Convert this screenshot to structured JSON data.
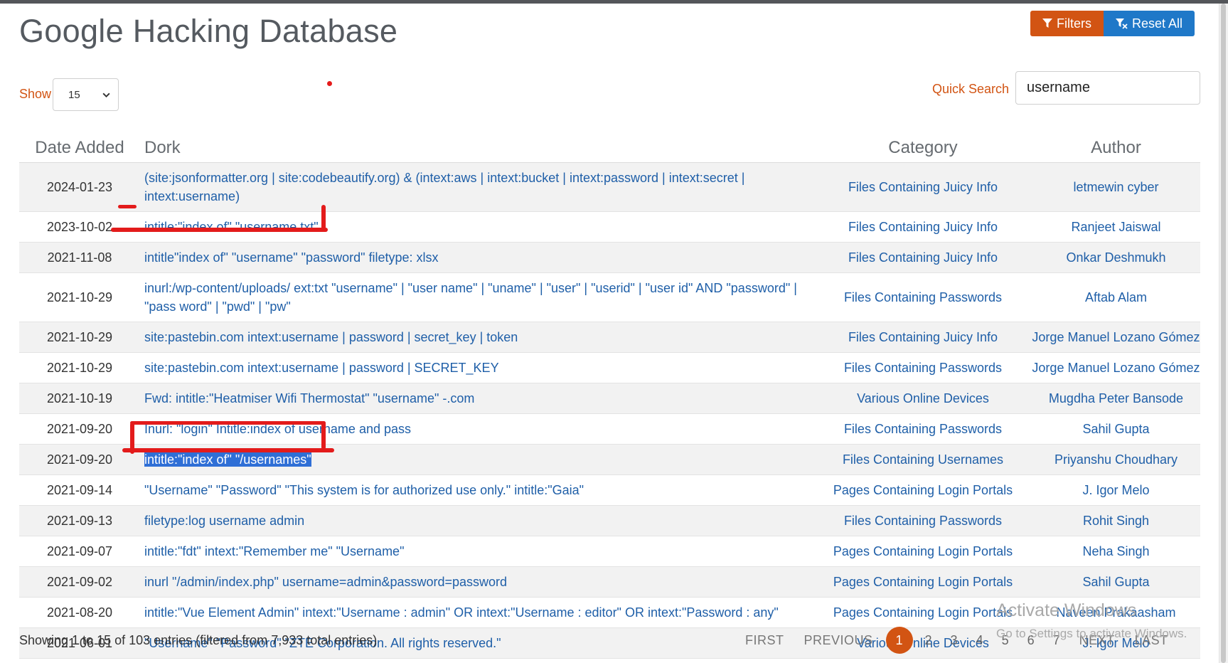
{
  "header": {
    "title": "Google Hacking Database",
    "filters_label": "Filters",
    "reset_label": "Reset All"
  },
  "controls": {
    "show_label": "Show",
    "show_value": "15",
    "quick_search_label": "Quick Search",
    "quick_search_value": "username"
  },
  "table": {
    "columns": [
      "Date Added",
      "Dork",
      "Category",
      "Author"
    ],
    "rows": [
      {
        "date": "2024-01-23",
        "dork": "(site:jsonformatter.org | site:codebeautify.org) & (intext:aws | intext:bucket | intext:password | intext:secret | intext:username)",
        "category": "Files Containing Juicy Info",
        "author": "letmewin cyber"
      },
      {
        "date": "2023-10-02",
        "dork": "intitle:\"index of\" \"username.txt\"",
        "category": "Files Containing Juicy Info",
        "author": "Ranjeet Jaiswal"
      },
      {
        "date": "2021-11-08",
        "dork": "intitle\"index of\" \"username\" \"password\" filetype: xlsx",
        "category": "Files Containing Juicy Info",
        "author": "Onkar Deshmukh"
      },
      {
        "date": "2021-10-29",
        "dork": "inurl:/wp-content/uploads/ ext:txt \"username\" | \"user name\" | \"uname\" | \"user\" | \"userid\" | \"user id\" AND \"password\" | \"pass word\" | \"pwd\" | \"pw\"",
        "category": "Files Containing Passwords",
        "author": "Aftab Alam"
      },
      {
        "date": "2021-10-29",
        "dork": "site:pastebin.com intext:username | password | secret_key | token",
        "category": "Files Containing Juicy Info",
        "author": "Jorge Manuel Lozano Gómez"
      },
      {
        "date": "2021-10-29",
        "dork": "site:pastebin.com intext:username | password | SECRET_KEY",
        "category": "Files Containing Passwords",
        "author": "Jorge Manuel Lozano Gómez"
      },
      {
        "date": "2021-10-19",
        "dork": "Fwd: intitle:\"Heatmiser Wifi Thermostat\" \"username\" -.com",
        "category": "Various Online Devices",
        "author": "Mugdha Peter Bansode"
      },
      {
        "date": "2021-09-20",
        "dork": "Inurl: \"login\" Intitle:index of username and pass",
        "category": "Files Containing Passwords",
        "author": "Sahil Gupta"
      },
      {
        "date": "2021-09-20",
        "dork": "intitle:\"index of\" \"/usernames\"",
        "category": "Files Containing Usernames",
        "author": "Priyanshu Choudhary"
      },
      {
        "date": "2021-09-14",
        "dork": "\"Username\" \"Password\" \"This system is for authorized use only.\" intitle:\"Gaia\"",
        "category": "Pages Containing Login Portals",
        "author": "J. Igor Melo"
      },
      {
        "date": "2021-09-13",
        "dork": "filetype:log username admin",
        "category": "Files Containing Passwords",
        "author": "Rohit Singh"
      },
      {
        "date": "2021-09-07",
        "dork": "intitle:\"fdt\" intext:\"Remember me\" \"Username\"",
        "category": "Pages Containing Login Portals",
        "author": "Neha Singh"
      },
      {
        "date": "2021-09-02",
        "dork": "inurl \"/admin/index.php\" username=admin&password=password",
        "category": "Pages Containing Login Portals",
        "author": "Sahil Gupta"
      },
      {
        "date": "2021-08-20",
        "dork": "intitle:\"Vue Element Admin\" intext:\"Username : admin\" OR intext:\"Username : editor\" OR intext:\"Password : any\"",
        "category": "Pages Containing Login Portals",
        "author": "Naveen Prakaasham"
      },
      {
        "date": "2021-06-01",
        "dork": "\"Username\" \"Password\" \"ZTE Corporation. All rights reserved.\"",
        "category": "Various Online Devices",
        "author": "J. Igor Melo"
      }
    ]
  },
  "footer": {
    "info": "Showing 1 to 15 of 103 entries (filtered from 7,933 total entries)",
    "pagination": {
      "first": "FIRST",
      "previous": "PREVIOUS",
      "pages": [
        "1",
        "2",
        "3",
        "4",
        "5",
        "6",
        "7"
      ],
      "active": "1",
      "next": "NEXT",
      "last": "LAST"
    }
  },
  "watermark": {
    "line1": "Activate Windows",
    "line2": "Go to Settings to activate Windows."
  },
  "colors": {
    "accent_orange": "#d25413",
    "accent_blue": "#1f78c8",
    "link_blue": "#1f5fa8",
    "annotation_red": "#e31b1b"
  },
  "icons": {
    "filters": "filter-icon",
    "reset": "clear-filter-icon",
    "select": "chevron-down-icon"
  }
}
